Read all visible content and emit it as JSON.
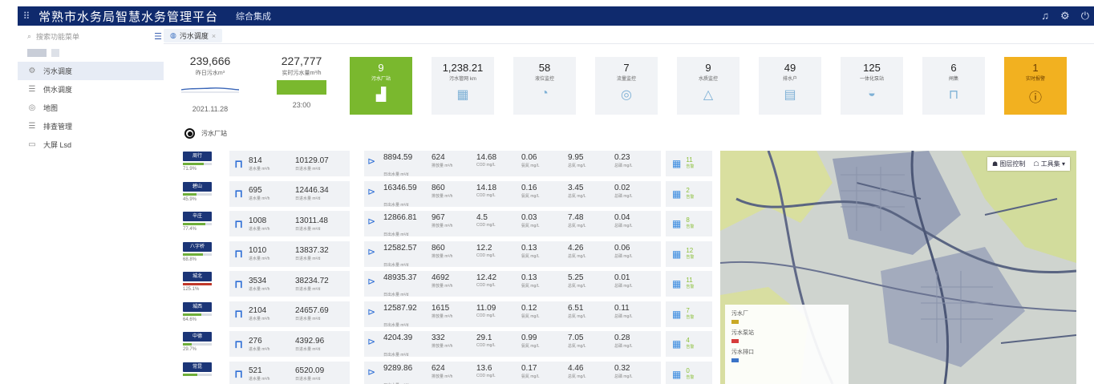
{
  "app": {
    "title": "常熟市水务局智慧水务管理平台",
    "subtitle": "综合集成"
  },
  "search": {
    "placeholder": "搜索功能菜单"
  },
  "tabs": [
    {
      "label": "污水调度"
    }
  ],
  "sidebar": {
    "items": [
      {
        "label": "污水调度",
        "icon": "gear-icon",
        "active": true
      },
      {
        "label": "供水调度",
        "icon": "list-icon"
      },
      {
        "label": "地图",
        "icon": "map-icon"
      },
      {
        "label": "排查管理",
        "icon": "list-icon"
      },
      {
        "label": "大屏 Lsd",
        "icon": "monitor-icon"
      }
    ]
  },
  "kpis": {
    "daily": {
      "value": "239,666",
      "label": "昨日污水m³",
      "date": "2021.11.28"
    },
    "realtime": {
      "value": "227,777",
      "label": "实时污水量m³/h",
      "time": "23:00"
    },
    "cards": [
      {
        "value": "9",
        "label": "污水厂站",
        "icon": "factory-icon",
        "style": "green"
      },
      {
        "value": "1,238.21",
        "label": "污水管网 km",
        "icon": "pipe-map-icon"
      },
      {
        "value": "58",
        "label": "液位监控",
        "icon": "gauge-icon"
      },
      {
        "value": "7",
        "label": "流量监控",
        "icon": "flow-icon"
      },
      {
        "value": "9",
        "label": "水质监控",
        "icon": "triangle-icon"
      },
      {
        "value": "49",
        "label": "排水户",
        "icon": "document-icon"
      },
      {
        "value": "125",
        "label": "一体化泵站",
        "icon": "pump-icon"
      },
      {
        "value": "6",
        "label": "闸集",
        "icon": "gate-icon"
      },
      {
        "value": "1",
        "label": "实时报警",
        "icon": "alert-icon",
        "style": "orange"
      }
    ]
  },
  "section": {
    "title": "污水厂站"
  },
  "units": {
    "inflow_rate": "进水量 m³/h",
    "inflow_day": "日进水量 m³/d",
    "outflow_day": "日出水量 m³/d",
    "outflow_rate": "排放量 m³/h",
    "cod": "COD mg/L",
    "nh": "氨氮 mg/L",
    "tn": "总氮 mg/L",
    "tp": "总磷 mg/L",
    "alarm": "告警"
  },
  "stations": [
    {
      "name": "周行",
      "pct": "71.9%",
      "load": 0.719,
      "in_rate": "814",
      "in_day": "10129.07",
      "out_day": "8894.59",
      "out_rate": "624",
      "cod": "14.68",
      "nh": "0.06",
      "tn": "9.95",
      "tp": "0.23",
      "alarm": "11"
    },
    {
      "name": "碧山",
      "pct": "45.9%",
      "load": 0.459,
      "in_rate": "695",
      "in_day": "12446.34",
      "out_day": "16346.59",
      "out_rate": "860",
      "cod": "14.18",
      "nh": "0.16",
      "tn": "3.45",
      "tp": "0.02",
      "alarm": "2"
    },
    {
      "name": "辛庄",
      "pct": "77.4%",
      "load": 0.774,
      "in_rate": "1008",
      "in_day": "13011.48",
      "out_day": "12866.81",
      "out_rate": "967",
      "cod": "4.5",
      "nh": "0.03",
      "tn": "7.48",
      "tp": "0.04",
      "alarm": "8"
    },
    {
      "name": "八字桥",
      "pct": "68.8%",
      "load": 0.688,
      "in_rate": "1010",
      "in_day": "13837.32",
      "out_day": "12582.57",
      "out_rate": "860",
      "cod": "12.2",
      "nh": "0.13",
      "tn": "4.26",
      "tp": "0.06",
      "alarm": "12"
    },
    {
      "name": "城北",
      "pct": "125.1%",
      "load": 1.0,
      "over": true,
      "in_rate": "3534",
      "in_day": "38234.72",
      "out_day": "48935.37",
      "out_rate": "4692",
      "cod": "12.42",
      "nh": "0.13",
      "tn": "5.25",
      "tp": "0.01",
      "alarm": "11"
    },
    {
      "name": "城西",
      "pct": "64.6%",
      "load": 0.646,
      "in_rate": "2104",
      "in_day": "24657.69",
      "out_day": "12587.92",
      "out_rate": "1615",
      "cod": "11.09",
      "nh": "0.12",
      "tn": "6.51",
      "tp": "0.11",
      "alarm": "7"
    },
    {
      "name": "中德",
      "pct": "29.7%",
      "load": 0.297,
      "in_rate": "276",
      "in_day": "4392.96",
      "out_day": "4204.39",
      "out_rate": "332",
      "cod": "29.1",
      "nh": "0.99",
      "tn": "7.05",
      "tp": "0.28",
      "alarm": "4"
    },
    {
      "name": "常昆",
      "pct": "",
      "load": 0.5,
      "in_rate": "521",
      "in_day": "6520.09",
      "out_day": "9289.86",
      "out_rate": "624",
      "cod": "13.6",
      "nh": "0.17",
      "tn": "4.46",
      "tp": "0.32",
      "alarm": "0"
    }
  ],
  "map": {
    "tools": {
      "layers": "图层控制",
      "toolbox": "工具集"
    },
    "legend": [
      {
        "label": "污水厂",
        "color": "#c9a825"
      },
      {
        "label": "污水泵站",
        "color": "#d63b3b"
      },
      {
        "label": "污水排口",
        "color": "#3a73c8"
      }
    ]
  },
  "colors": {
    "header": "#0f2a6d",
    "accent_green": "#7ab82e",
    "alarm_orange": "#f2b120"
  }
}
